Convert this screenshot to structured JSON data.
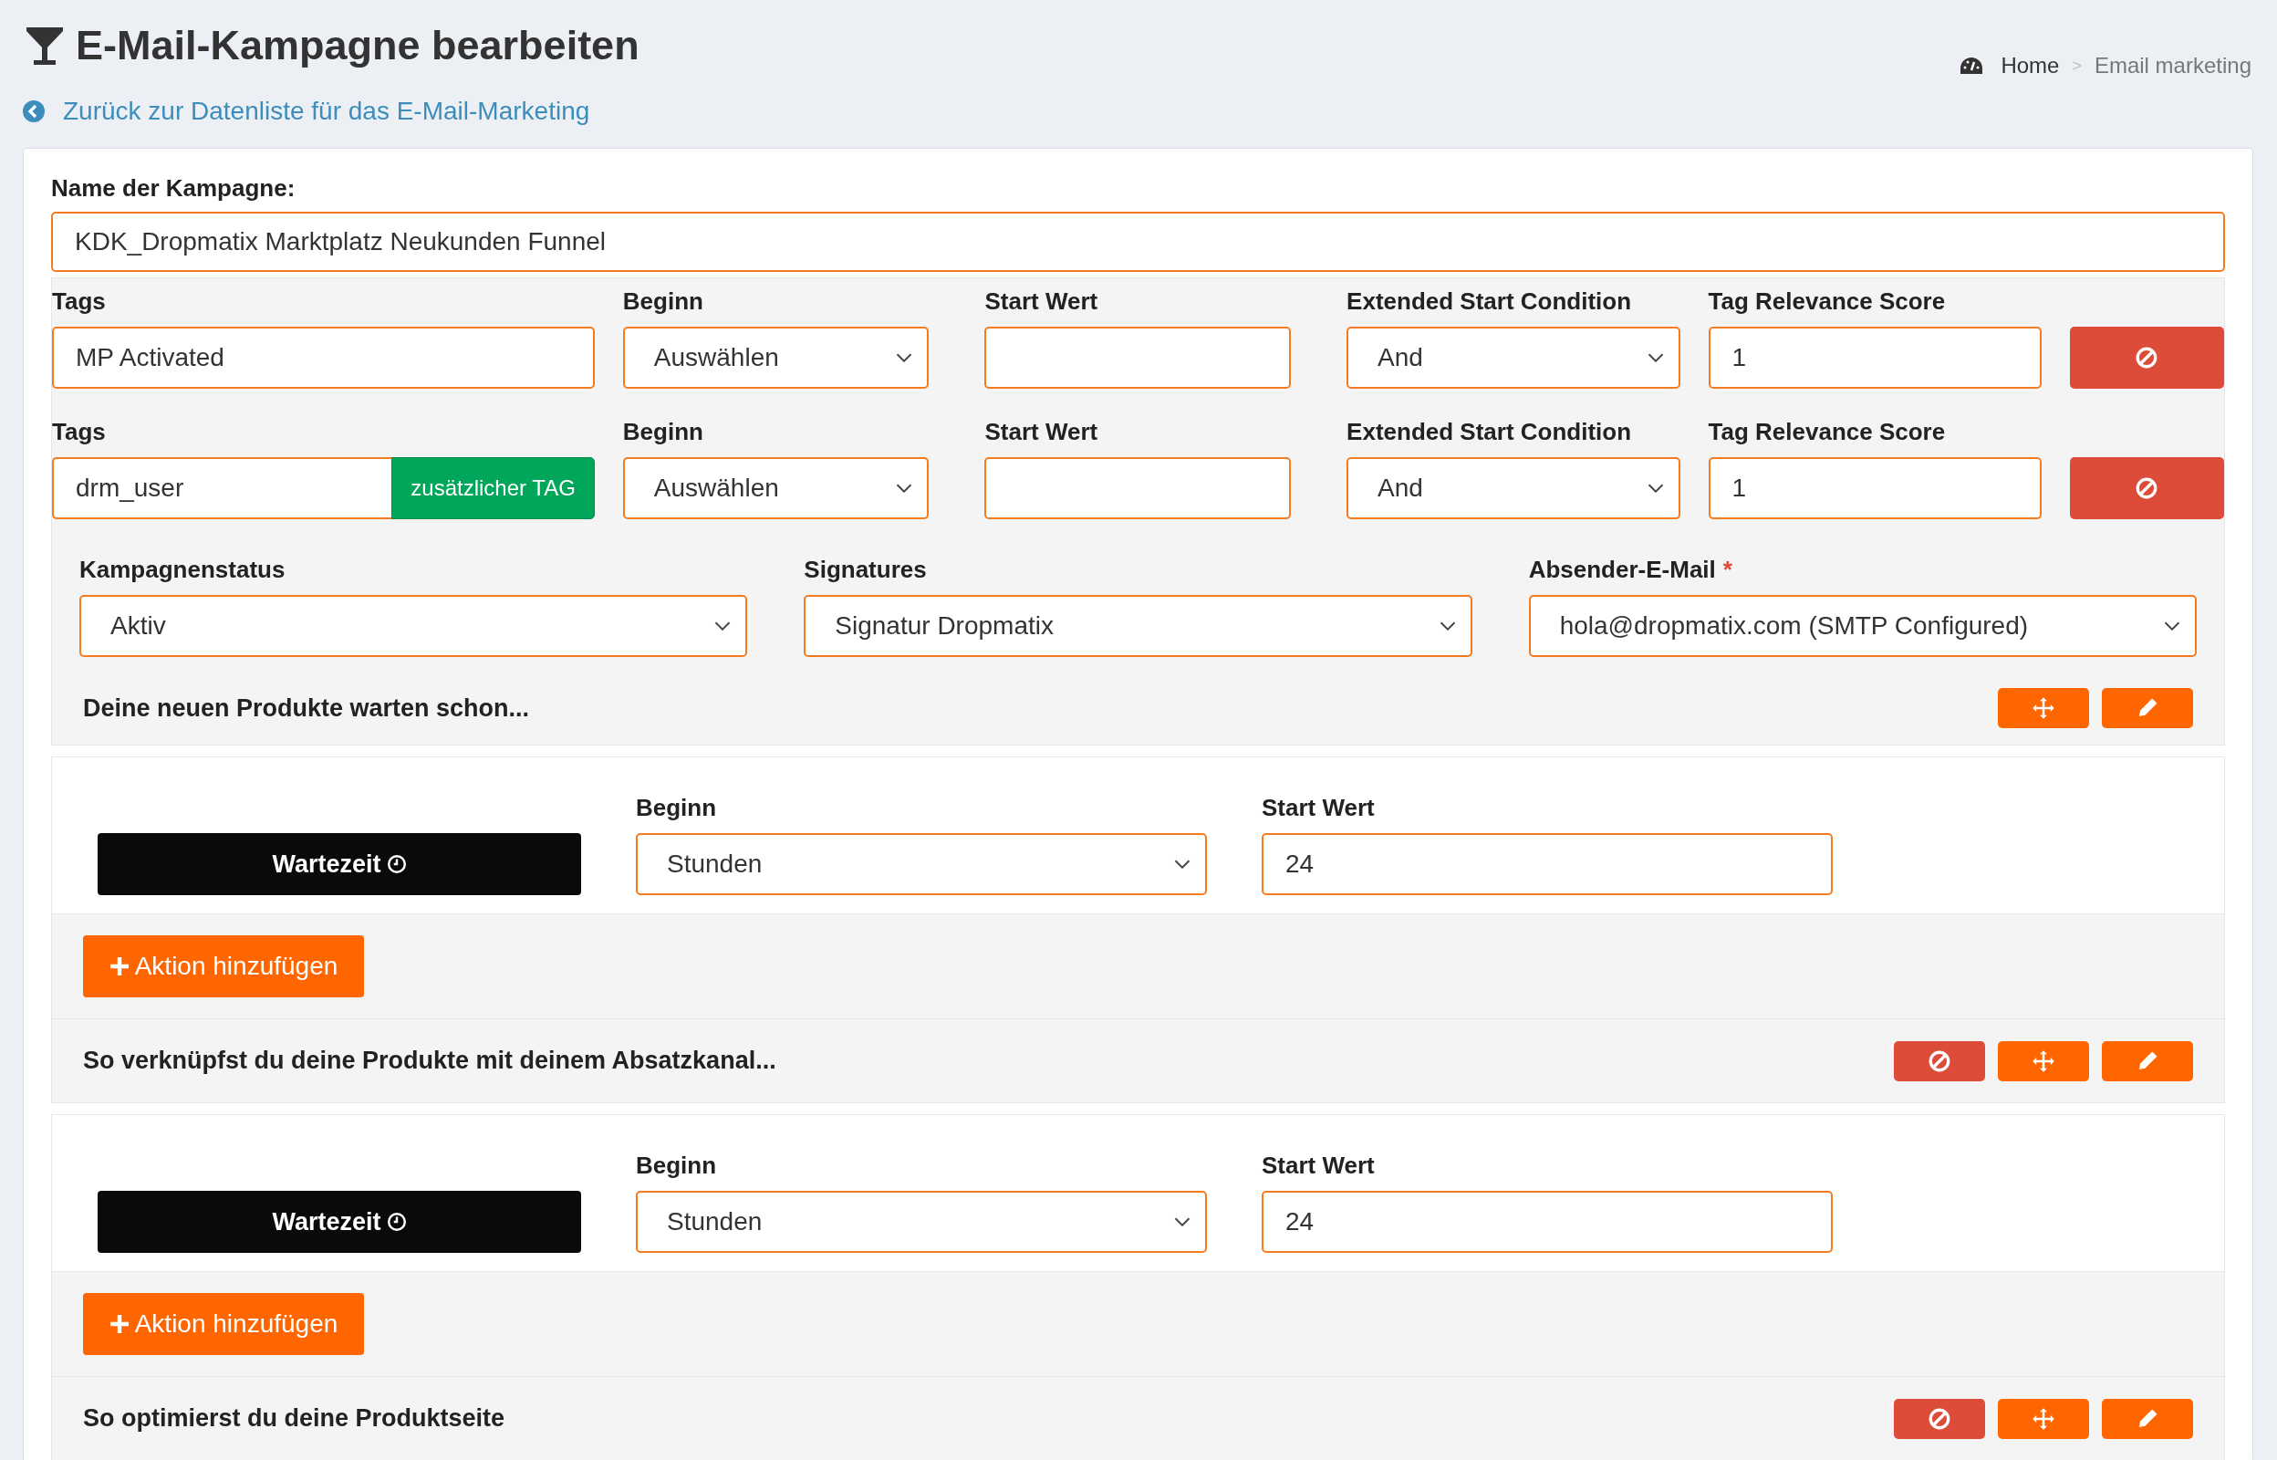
{
  "header": {
    "title": "E-Mail-Kampagne bearbeiten",
    "back_link": "Zurück zur Datenliste für das E-Mail-Marketing"
  },
  "breadcrumb": {
    "separator": ">",
    "items": [
      {
        "label": "Home",
        "selected": false
      },
      {
        "label": "Email marketing",
        "selected": true
      }
    ]
  },
  "campaign_name": {
    "label": "Name der Kampagne:",
    "value": "KDK_Dropmatix Marktplatz Neukunden Funnel"
  },
  "tag_rows": [
    {
      "tags_label": "Tags",
      "tags_value": "MP Activated",
      "beginn_label": "Beginn",
      "beginn_value": "Auswählen",
      "start_label": "Start Wert",
      "condition_label": "Extended Start Condition",
      "condition_value": "And",
      "score_label": "Tag Relevance Score",
      "score_value": "1"
    },
    {
      "tags_label": "Tags",
      "tags_value": "drm_user",
      "extra_button": "zusätzlicher TAG",
      "beginn_label": "Beginn",
      "beginn_value": "Auswählen",
      "start_label": "Start Wert",
      "condition_label": "Extended Start Condition",
      "condition_value": "And",
      "score_label": "Tag Relevance Score",
      "score_value": "1"
    }
  ],
  "settings": [
    {
      "label": "Kampagnenstatus",
      "value": "Aktiv"
    },
    {
      "label": "Signatures",
      "value": "Signatur Dropmatix"
    },
    {
      "label": "Absender-E-Mail",
      "required_mark": "*",
      "value": "hola@dropmatix.com (SMTP Configured)"
    }
  ],
  "steps": [
    {
      "kind": "message",
      "text": "Deine neuen Produkte warten schon...",
      "buttons": [
        {
          "kind": "move"
        },
        {
          "kind": "edit"
        }
      ]
    },
    {
      "kind": "wait",
      "button_label": "Wartezeit",
      "beginn_label": "Beginn",
      "beginn_value": "Stunden",
      "start_label": "Start Wert",
      "start_value": "24",
      "add_action": "Aktion hinzufügen"
    },
    {
      "kind": "message",
      "text": "So verknüpfst du deine Produkte mit deinem Absatzkanal...",
      "buttons": [
        {
          "kind": "delete"
        },
        {
          "kind": "move"
        },
        {
          "kind": "edit"
        }
      ]
    },
    {
      "kind": "wait",
      "button_label": "Wartezeit",
      "beginn_label": "Beginn",
      "beginn_value": "Stunden",
      "start_label": "Start Wert",
      "start_value": "24",
      "add_action": "Aktion hinzufügen"
    },
    {
      "kind": "message",
      "text": "So optimierst du deine Produktseite",
      "buttons": [
        {
          "kind": "delete"
        },
        {
          "kind": "move"
        },
        {
          "kind": "edit"
        }
      ]
    }
  ]
}
